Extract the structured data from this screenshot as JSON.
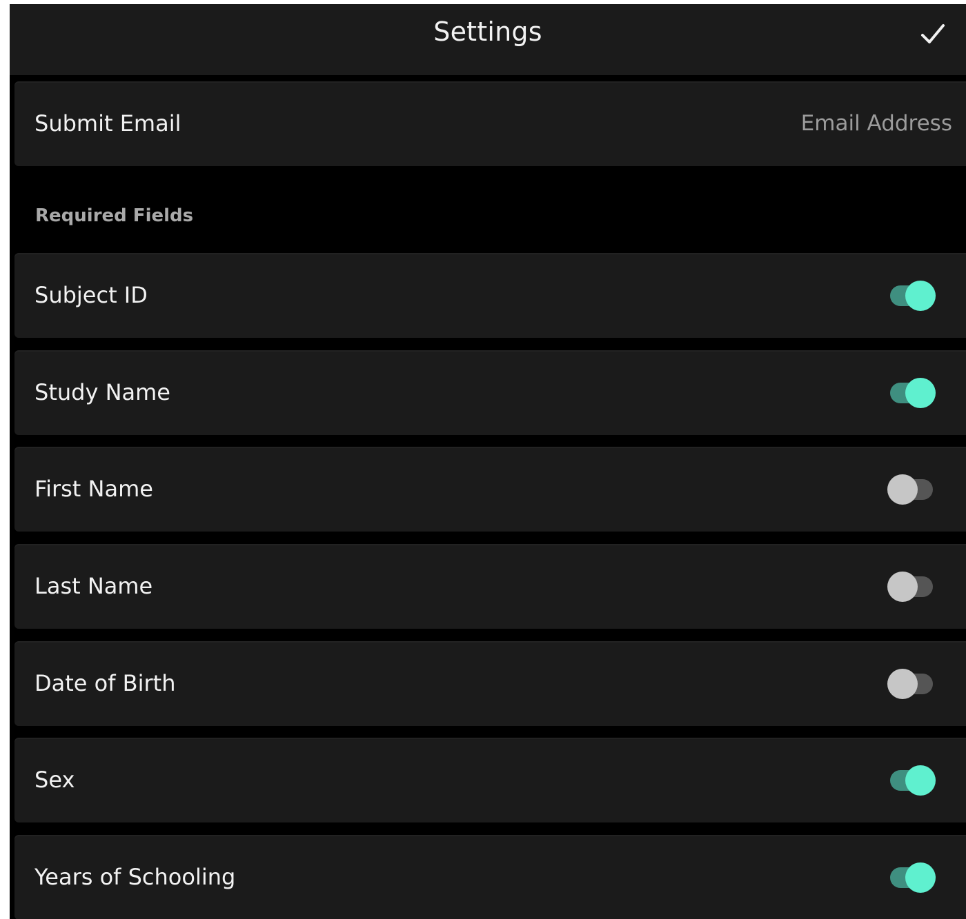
{
  "header": {
    "title": "Settings",
    "done_icon": "checkmark-icon"
  },
  "submit_email": {
    "label": "Submit Email",
    "value": "",
    "placeholder": "Email Address"
  },
  "required_fields": {
    "section_title": "Required Fields",
    "items": [
      {
        "label": "Subject ID",
        "enabled": true
      },
      {
        "label": "Study Name",
        "enabled": true
      },
      {
        "label": "First Name",
        "enabled": false
      },
      {
        "label": "Last Name",
        "enabled": false
      },
      {
        "label": "Date of Birth",
        "enabled": false
      },
      {
        "label": "Sex",
        "enabled": true
      },
      {
        "label": "Years of Schooling",
        "enabled": true
      }
    ]
  },
  "colors": {
    "background": "#000000",
    "panel": "#1b1b1b",
    "text": "#f2f2f2",
    "muted_text": "#a9a9a9",
    "toggle_on_knob": "#5ff0cf",
    "toggle_on_track": "#3f8f80",
    "toggle_off_knob": "#c6c6c6",
    "toggle_off_track": "#555555"
  }
}
